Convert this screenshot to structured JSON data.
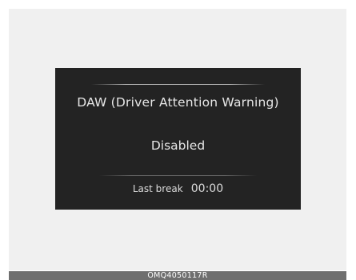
{
  "display": {
    "title": "DAW (Driver Attention Warning)",
    "status": "Disabled",
    "last_break_label": "Last break",
    "last_break_time": "00:00"
  },
  "footer": {
    "code": "OMQ4050117R"
  },
  "colors": {
    "display_background": "#232323",
    "display_text": "#e6e6e6",
    "outer_panel": "#f0f0f0",
    "footer_bar": "#6f6f6f"
  }
}
